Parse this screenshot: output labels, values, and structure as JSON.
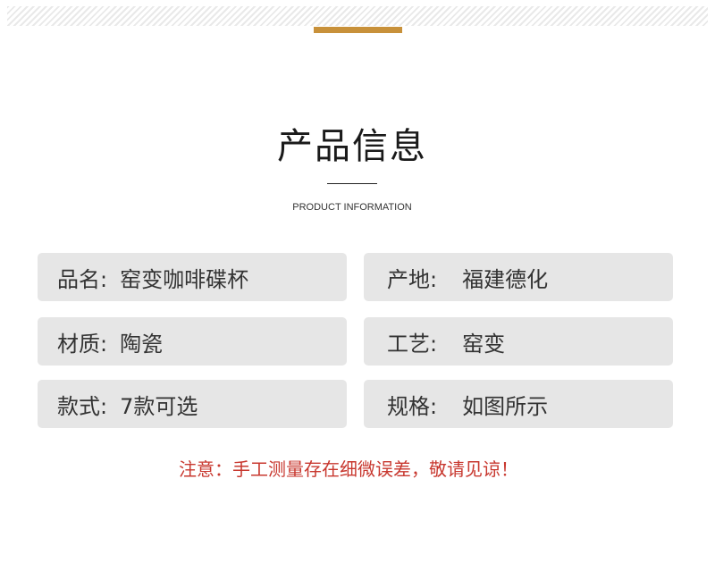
{
  "header": {
    "accent_color": "#c8913a"
  },
  "title": {
    "main": "产品信息",
    "sub": "PRODUCT INFORMATION"
  },
  "info_items": {
    "name": {
      "label": "品名:",
      "value": "窑变咖啡碟杯"
    },
    "origin": {
      "label": "产地:",
      "value": "福建德化"
    },
    "material": {
      "label": "材质:",
      "value": "陶瓷"
    },
    "craft": {
      "label": "工艺:",
      "value": "窑变"
    },
    "style": {
      "label": "款式:",
      "value": "7款可选"
    },
    "spec": {
      "label": "规格:",
      "value": "如图所示"
    }
  },
  "notice": {
    "text": "注意：手工测量存在细微误差，敬请见谅！",
    "color": "#c8382f"
  }
}
